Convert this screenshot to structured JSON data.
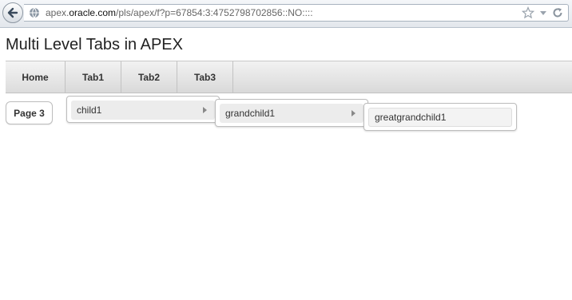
{
  "browser": {
    "url_prefix": "apex.",
    "url_domain": "oracle.com",
    "url_path": "/pls/apex/f?p=67854:3:4752798702856::NO::::"
  },
  "page": {
    "title": "Multi Level Tabs in APEX"
  },
  "tabs": [
    {
      "label": "Home"
    },
    {
      "label": "Tab1"
    },
    {
      "label": "Tab2"
    },
    {
      "label": "Tab3"
    }
  ],
  "page3_button": "Page 3",
  "menus": {
    "level1": {
      "label": "child1"
    },
    "level2": {
      "label": "grandchild1"
    },
    "level3": {
      "label": "greatgrandchild1"
    }
  }
}
